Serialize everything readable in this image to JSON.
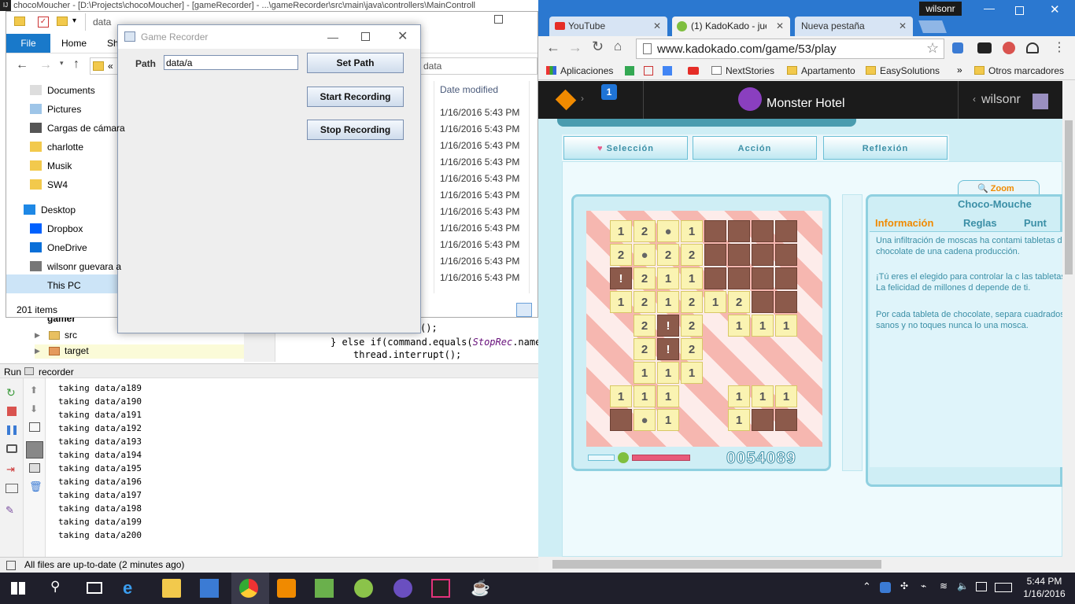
{
  "ide": {
    "title": "chocoMoucher - [D:\\Projects\\chocoMoucher] - [gameRecorder] - ...\\gameRecorder\\src\\main\\java\\controllers\\MainControll",
    "tree": {
      "root": "gamer",
      "items": [
        "src",
        "target"
      ]
    },
    "code": {
      "line1_end": "();",
      "line2_a": "} else if(command.equals(",
      "line2_b": "StopRec",
      "line2_c": ".name",
      "line3": "thread.interrupt();"
    },
    "run": {
      "tab_prefix": "Run",
      "config": "recorder",
      "lines": [
        "taking data/a189",
        "taking data/a190",
        "taking data/a191",
        "taking data/a192",
        "taking data/a193",
        "taking data/a194",
        "taking data/a195",
        "taking data/a196",
        "taking data/a197",
        "taking data/a198",
        "taking data/a199",
        "taking data/a200"
      ]
    },
    "status": "All files are up-to-date (2 minutes ago)"
  },
  "explorer": {
    "title_path": "data",
    "tabs": {
      "file": "File",
      "home": "Home",
      "share": "Sh"
    },
    "address": "«",
    "search_crumb": "data",
    "column_date": "Date modified",
    "nav": [
      "Documents",
      "Pictures",
      "Cargas de cámara",
      "charlotte",
      "Musik",
      "SW4",
      "Desktop",
      "Dropbox",
      "OneDrive",
      "wilsonr guevara a",
      "This PC"
    ],
    "dates": [
      "1/16/2016 5:43 PM",
      "1/16/2016 5:43 PM",
      "1/16/2016 5:43 PM",
      "1/16/2016 5:43 PM",
      "1/16/2016 5:43 PM",
      "1/16/2016 5:43 PM",
      "1/16/2016 5:43 PM",
      "1/16/2016 5:43 PM",
      "1/16/2016 5:43 PM",
      "1/16/2016 5:43 PM",
      "1/16/2016 5:43 PM"
    ],
    "item_count": "201 items"
  },
  "recorder": {
    "title": "Game Recorder",
    "path_label": "Path",
    "path_value": "data/a",
    "set_path": "Set Path",
    "start": "Start Recording",
    "stop": "Stop Recording"
  },
  "chrome": {
    "user": "wilsonr",
    "tabs": [
      "YouTube",
      "(1) KadoKado - jueg",
      "Nueva pestaña"
    ],
    "url": "www.kadokado.com/game/53/play",
    "bookmarks": [
      "Aplicaciones",
      "NextStories",
      "Apartamento",
      "EasySolutions"
    ],
    "more": "»",
    "other_bookmarks": "Otros marcadores"
  },
  "kadokado": {
    "badge": "1",
    "game_title": "Monster Hotel",
    "user": "wilsonr",
    "tabs": [
      "Selección",
      "Acción",
      "Reflexión"
    ],
    "zoom": "Zoom",
    "game_name": "Choco-Mouche",
    "info_tabs": [
      "Información",
      "Reglas",
      "Punt"
    ],
    "p1": "Una infiltración de moscas ha contami tabletas de chocolate de una cadena producción.",
    "p2": "¡Tú eres el elegido para controlar la c las tabletas! La felicidad de millones d depende de ti.",
    "p3": "Por cada tableta de chocolate, separa cuadrados sanos y no toques nunca lo una mosca.",
    "score": "0054089"
  },
  "taskbar": {
    "time": "5:44 PM",
    "date": "1/16/2016"
  },
  "colors": {
    "chrome_tab_bar": "#2b78d0",
    "taskbar": "#1f1f2b",
    "kadokado_bar": "#1b1b1b",
    "accent_orange": "#f08a00"
  }
}
